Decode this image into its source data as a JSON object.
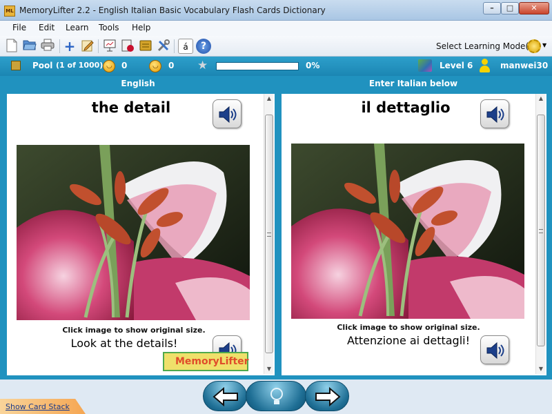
{
  "window": {
    "title": "MemoryLifter 2.2 - English Italian Basic Vocabulary Flash Cards Dictionary",
    "logo_text": "ML"
  },
  "menu": [
    "File",
    "Edit",
    "Learn",
    "Tools",
    "Help"
  ],
  "toolbar": {
    "icons": [
      "new-icon",
      "open-icon",
      "print-icon",
      "add-icon",
      "edit-icon",
      "presentation-icon",
      "statistics-icon",
      "card-box-icon",
      "settings-icon",
      "special-chars-icon",
      "help-icon"
    ],
    "special_char_label": "á",
    "help_label": "?",
    "learning_mode_label": "Select Learning Mode(s)"
  },
  "status": {
    "pool_label": "Pool",
    "pool_count": "(1 of 1000)",
    "correct_count": "0",
    "wrong_count": "0",
    "progress_percent": 0,
    "progress_text": "0%",
    "level": "Level 6",
    "user": "manwei30"
  },
  "question": {
    "language_label": "English",
    "word": "the detail",
    "caption": "Click image to show original size.",
    "example": "Look at the details!",
    "logo_text": "MemoryLifter"
  },
  "answer": {
    "language_label": "Enter Italian below",
    "word": "il dettaglio",
    "caption": "Click image to show original size.",
    "example": "Attenzione ai dettagli!"
  },
  "footer": {
    "show_card_stack": "Show Card Stack"
  },
  "colors": {
    "accent": "#2092bf",
    "progress": "#3eb44a"
  }
}
